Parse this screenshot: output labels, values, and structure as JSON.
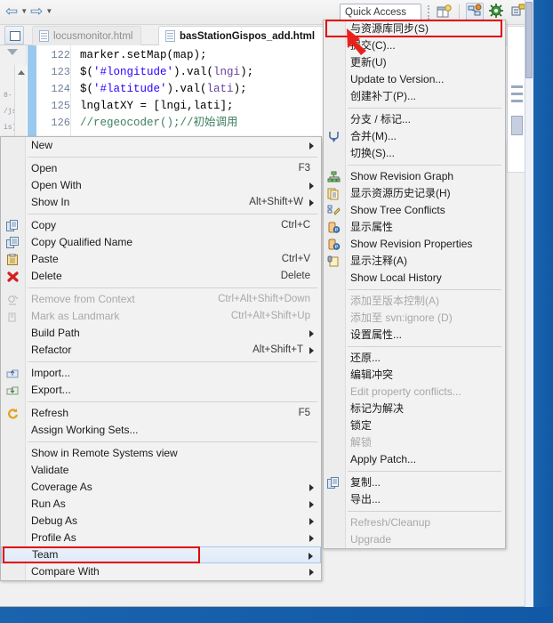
{
  "toolbar": {
    "back_icon": "back-arrow-icon",
    "forward_icon": "forward-arrow-icon",
    "quick_access_value": "Quick Access",
    "quick_access_placeholder": "Quick Access",
    "icons": [
      "perspective-open-icon",
      "java-ee-perspective-icon",
      "debug-perspective-icon",
      "team-sync-perspective-icon"
    ]
  },
  "tabs": [
    {
      "label": "locusmonitor.html",
      "active": false,
      "icon": "html-file-icon"
    },
    {
      "label": "basStationGispos_add.html",
      "active": true,
      "icon": "html-file-icon"
    }
  ],
  "editor": {
    "minimap_labels": [
      "8-",
      "/js",
      "is)"
    ],
    "line_numbers": [
      "122",
      "123",
      "124",
      "125",
      "126"
    ],
    "lines": [
      {
        "segments": [
          {
            "t": "marker.setMap(map);",
            "c": "plain"
          }
        ]
      },
      {
        "segments": [
          {
            "t": "$(",
            "c": "plain"
          },
          {
            "t": "'#longitude'",
            "c": "k-str"
          },
          {
            "t": ").val(",
            "c": "plain"
          },
          {
            "t": "lngi",
            "c": "k-var"
          },
          {
            "t": ");",
            "c": "plain"
          }
        ]
      },
      {
        "segments": [
          {
            "t": "$(",
            "c": "plain"
          },
          {
            "t": "'#latitude'",
            "c": "k-str"
          },
          {
            "t": ").val(",
            "c": "plain"
          },
          {
            "t": "lati",
            "c": "k-var"
          },
          {
            "t": ");",
            "c": "plain"
          }
        ]
      },
      {
        "segments": [
          {
            "t": "lnglatXY = [lngi,lati];",
            "c": "plain"
          }
        ]
      },
      {
        "segments": [
          {
            "t": "//regeocoder();//初始调用",
            "c": "k-com"
          }
        ]
      }
    ]
  },
  "context_menu": {
    "items": [
      {
        "label": "New",
        "shortcut": "",
        "arrow": true,
        "icon": "",
        "disabled": false
      },
      {
        "separator": true
      },
      {
        "label": "Open",
        "shortcut": "F3",
        "arrow": false,
        "icon": "",
        "disabled": false
      },
      {
        "label": "Open With",
        "shortcut": "",
        "arrow": true,
        "icon": "",
        "disabled": false
      },
      {
        "label": "Show In",
        "shortcut": "Alt+Shift+W",
        "arrow": true,
        "icon": "",
        "disabled": false
      },
      {
        "separator": true
      },
      {
        "label": "Copy",
        "shortcut": "Ctrl+C",
        "arrow": false,
        "icon": "copy-icon",
        "disabled": false
      },
      {
        "label": "Copy Qualified Name",
        "shortcut": "",
        "arrow": false,
        "icon": "copy-qualified-icon",
        "disabled": false
      },
      {
        "label": "Paste",
        "shortcut": "Ctrl+V",
        "arrow": false,
        "icon": "paste-icon",
        "disabled": false
      },
      {
        "label": "Delete",
        "shortcut": "Delete",
        "arrow": false,
        "icon": "delete-x-icon",
        "disabled": false
      },
      {
        "separator": true
      },
      {
        "label": "Remove from Context",
        "shortcut": "Ctrl+Alt+Shift+Down",
        "arrow": false,
        "icon": "remove-context-icon",
        "disabled": true
      },
      {
        "label": "Mark as Landmark",
        "shortcut": "Ctrl+Alt+Shift+Up",
        "arrow": false,
        "icon": "landmark-icon",
        "disabled": true
      },
      {
        "label": "Build Path",
        "shortcut": "",
        "arrow": true,
        "icon": "",
        "disabled": false
      },
      {
        "label": "Refactor",
        "shortcut": "Alt+Shift+T",
        "arrow": true,
        "icon": "",
        "disabled": false
      },
      {
        "separator": true
      },
      {
        "label": "Import...",
        "shortcut": "",
        "arrow": false,
        "icon": "import-icon",
        "disabled": false
      },
      {
        "label": "Export...",
        "shortcut": "",
        "arrow": false,
        "icon": "export-icon",
        "disabled": false
      },
      {
        "separator": true
      },
      {
        "label": "Refresh",
        "shortcut": "F5",
        "arrow": false,
        "icon": "refresh-icon",
        "disabled": false
      },
      {
        "label": "Assign Working Sets...",
        "shortcut": "",
        "arrow": false,
        "icon": "",
        "disabled": false
      },
      {
        "separator": true
      },
      {
        "label": "Show in Remote Systems view",
        "shortcut": "",
        "arrow": false,
        "icon": "",
        "disabled": false
      },
      {
        "label": "Validate",
        "shortcut": "",
        "arrow": false,
        "icon": "",
        "disabled": false
      },
      {
        "label": "Coverage As",
        "shortcut": "",
        "arrow": true,
        "icon": "",
        "disabled": false
      },
      {
        "label": "Run As",
        "shortcut": "",
        "arrow": true,
        "icon": "",
        "disabled": false
      },
      {
        "label": "Debug As",
        "shortcut": "",
        "arrow": true,
        "icon": "",
        "disabled": false
      },
      {
        "label": "Profile As",
        "shortcut": "",
        "arrow": true,
        "icon": "",
        "disabled": false
      },
      {
        "label": "Team",
        "shortcut": "",
        "arrow": true,
        "icon": "",
        "disabled": false,
        "selected": true,
        "highlighted": true
      },
      {
        "label": "Compare With",
        "shortcut": "",
        "arrow": true,
        "icon": "",
        "disabled": false
      }
    ]
  },
  "submenu": {
    "items": [
      {
        "label": "与资源库同步(S)",
        "icon": "",
        "disabled": false,
        "highlighted": true
      },
      {
        "label": "提交(C)...",
        "icon": "",
        "disabled": false
      },
      {
        "label": "更新(U)",
        "icon": "",
        "disabled": false
      },
      {
        "label": "Update to Version...",
        "icon": "",
        "disabled": false
      },
      {
        "label": "创建补丁(P)...",
        "icon": "",
        "disabled": false
      },
      {
        "separator": true
      },
      {
        "label": "分支 / 标记...",
        "icon": "",
        "disabled": false
      },
      {
        "label": "合并(M)...",
        "icon": "merge-branch-icon",
        "disabled": false
      },
      {
        "label": "切换(S)...",
        "icon": "",
        "disabled": false
      },
      {
        "separator": true
      },
      {
        "label": "Show Revision Graph",
        "icon": "revision-graph-icon",
        "disabled": false
      },
      {
        "label": "显示资源历史记录(H)",
        "icon": "history-icon",
        "disabled": false
      },
      {
        "label": "Show Tree Conflicts",
        "icon": "tree-conflicts-icon",
        "disabled": false
      },
      {
        "label": "显示属性",
        "icon": "properties-icon",
        "disabled": false
      },
      {
        "label": "Show Revision Properties",
        "icon": "revision-properties-icon",
        "disabled": false
      },
      {
        "label": "显示注释(A)",
        "icon": "annotate-icon",
        "disabled": false
      },
      {
        "label": "Show Local History",
        "icon": "",
        "disabled": false
      },
      {
        "separator": true
      },
      {
        "label": "添加至版本控制(A)",
        "icon": "",
        "disabled": true
      },
      {
        "label": "添加至 svn:ignore (D)",
        "icon": "",
        "disabled": true
      },
      {
        "label": "设置属性...",
        "icon": "",
        "disabled": false
      },
      {
        "separator": true
      },
      {
        "label": "还原...",
        "icon": "",
        "disabled": false
      },
      {
        "label": "编辑冲突",
        "icon": "",
        "disabled": false
      },
      {
        "label": "Edit property conflicts...",
        "icon": "",
        "disabled": true
      },
      {
        "label": "标记为解决",
        "icon": "",
        "disabled": false
      },
      {
        "label": "锁定",
        "icon": "",
        "disabled": false
      },
      {
        "label": "解锁",
        "icon": "",
        "disabled": true
      },
      {
        "label": "Apply Patch...",
        "icon": "",
        "disabled": false
      },
      {
        "separator": true
      },
      {
        "label": "复制...",
        "icon": "copy-icon",
        "disabled": false
      },
      {
        "label": "导出...",
        "icon": "",
        "disabled": false
      },
      {
        "separator": true
      },
      {
        "label": "Refresh/Cleanup",
        "icon": "",
        "disabled": true
      },
      {
        "label": "Upgrade",
        "icon": "",
        "disabled": true
      }
    ]
  },
  "annotations": {
    "arrow_color": "#e8221a",
    "highlight_box_color": "#e00000"
  }
}
